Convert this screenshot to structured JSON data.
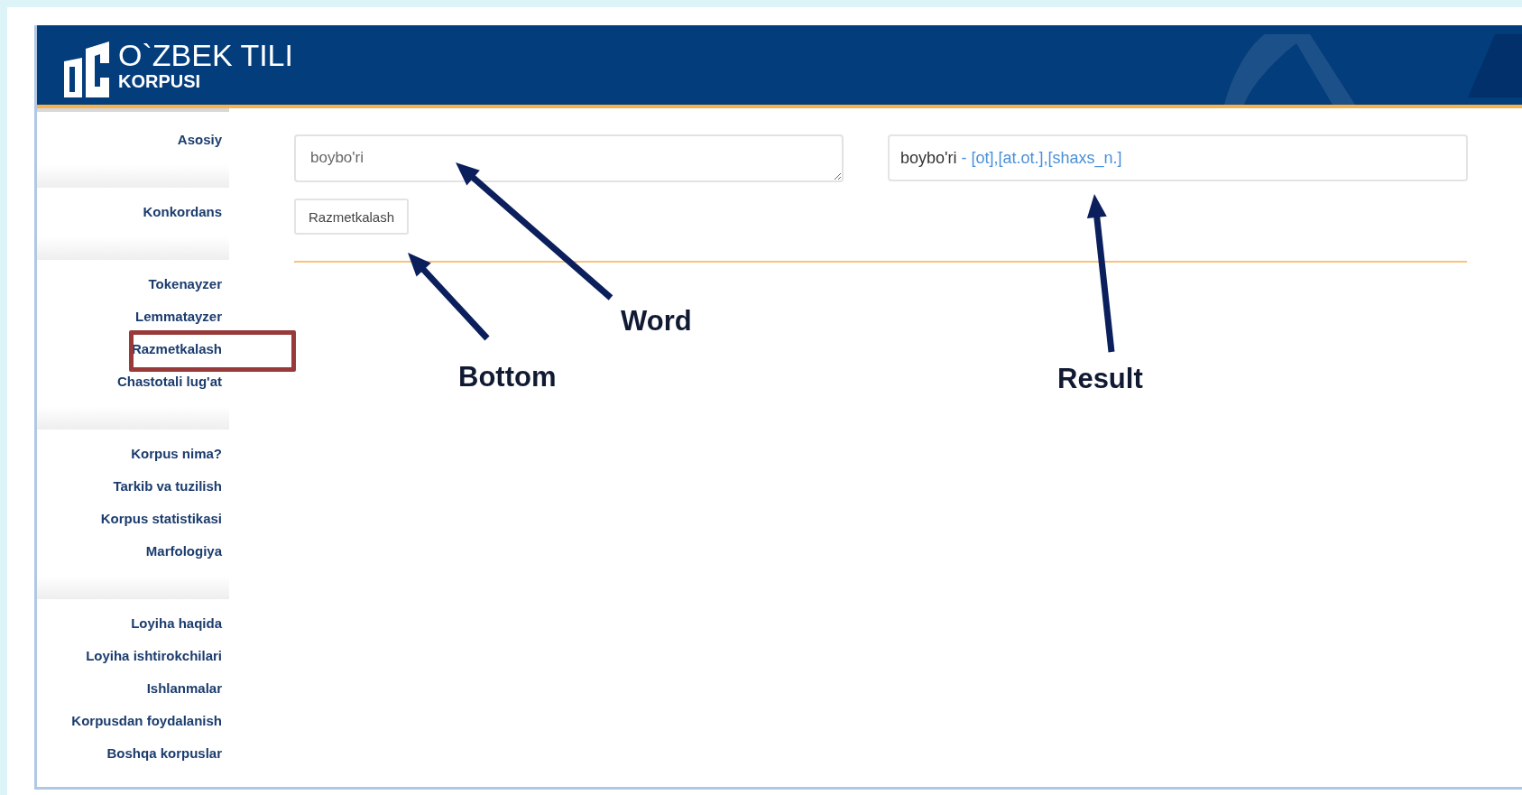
{
  "header": {
    "title": "O`ZBEK TILI",
    "subtitle": "KORPUSI"
  },
  "sidebar": {
    "groups": [
      {
        "items": [
          {
            "label": "Asosiy",
            "boxed": false
          }
        ]
      },
      {
        "items": [
          {
            "label": "Konkordans",
            "boxed": false
          }
        ]
      },
      {
        "items": [
          {
            "label": "Tokenayzer",
            "boxed": false
          },
          {
            "label": "Lemmatayzer",
            "boxed": false
          },
          {
            "label": "Razmetkalash",
            "boxed": true
          },
          {
            "label": "Chastotali lug'at",
            "boxed": false
          }
        ]
      },
      {
        "items": [
          {
            "label": "Korpus nima?",
            "boxed": false
          },
          {
            "label": "Tarkib va tuzilish",
            "boxed": false
          },
          {
            "label": "Korpus statistikasi",
            "boxed": false
          },
          {
            "label": "Marfologiya",
            "boxed": false
          }
        ]
      },
      {
        "items": [
          {
            "label": "Loyiha haqida",
            "boxed": false
          },
          {
            "label": "Loyiha ishtirokchilari",
            "boxed": false
          },
          {
            "label": "Ishlanmalar",
            "boxed": false
          },
          {
            "label": "Korpusdan foydalanish",
            "boxed": false
          },
          {
            "label": "Boshqa korpuslar",
            "boxed": false
          }
        ]
      }
    ]
  },
  "input": {
    "value": "boybo'ri"
  },
  "button": "Razmetkalash",
  "result": {
    "word": "boybo'ri",
    "tags": " - [ot],[at.ot.],[shaxs_n.]"
  },
  "annotations": [
    {
      "label": "Word"
    },
    {
      "label": "Bottom"
    },
    {
      "label": "Result"
    }
  ]
}
